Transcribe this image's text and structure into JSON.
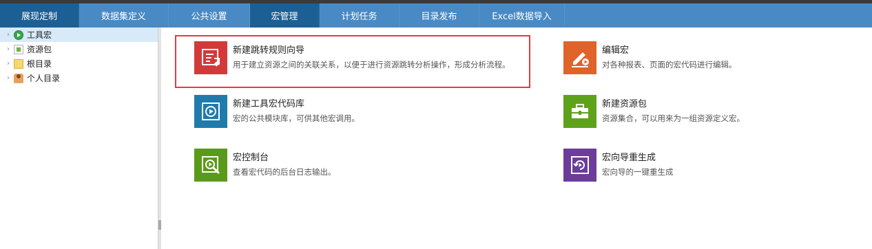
{
  "nav": {
    "tabs": [
      {
        "label": "展现定制"
      },
      {
        "label": "数据集定义"
      },
      {
        "label": "公共设置"
      },
      {
        "label": "宏管理"
      },
      {
        "label": "计划任务"
      },
      {
        "label": "目录发布"
      },
      {
        "label": "Excel数据导入"
      }
    ],
    "active_index": 3
  },
  "sidebar": {
    "items": [
      {
        "label": "工具宏",
        "icon": "tool-macro-icon",
        "selected": true
      },
      {
        "label": "资源包",
        "icon": "package-icon",
        "selected": false
      },
      {
        "label": "根目录",
        "icon": "folder-icon",
        "selected": false
      },
      {
        "label": "个人目录",
        "icon": "user-folder-icon",
        "selected": false
      }
    ]
  },
  "cards": [
    {
      "title": "新建跳转规则向导",
      "desc": "用于建立资源之间的关联关系，以便于进行资源跳转分析操作，形成分析流程。",
      "color": "#d23a3a",
      "icon": "jump-rule-icon"
    },
    {
      "title": "编辑宏",
      "desc": "对各种报表、页面的宏代码进行编辑。",
      "color": "#e0632a",
      "icon": "edit-macro-icon"
    },
    {
      "title": "新建工具宏代码库",
      "desc": "宏的公共模块库，可供其他宏调用。",
      "color": "#1f7bab",
      "icon": "code-library-icon"
    },
    {
      "title": "新建资源包",
      "desc": "资源集合，可以用来为一组资源定义宏。",
      "color": "#5ea21a",
      "icon": "briefcase-icon"
    },
    {
      "title": "宏控制台",
      "desc": "查看宏代码的后台日志输出。",
      "color": "#5a9a1a",
      "icon": "console-icon"
    },
    {
      "title": "宏向导重生成",
      "desc": "宏向导的一键重生成",
      "color": "#6c3c9a",
      "icon": "regenerate-icon"
    }
  ],
  "colors": {
    "nav_bg": "#4a8ac4",
    "nav_active": "#1c5f94",
    "highlight_border": "#e43b3b"
  }
}
